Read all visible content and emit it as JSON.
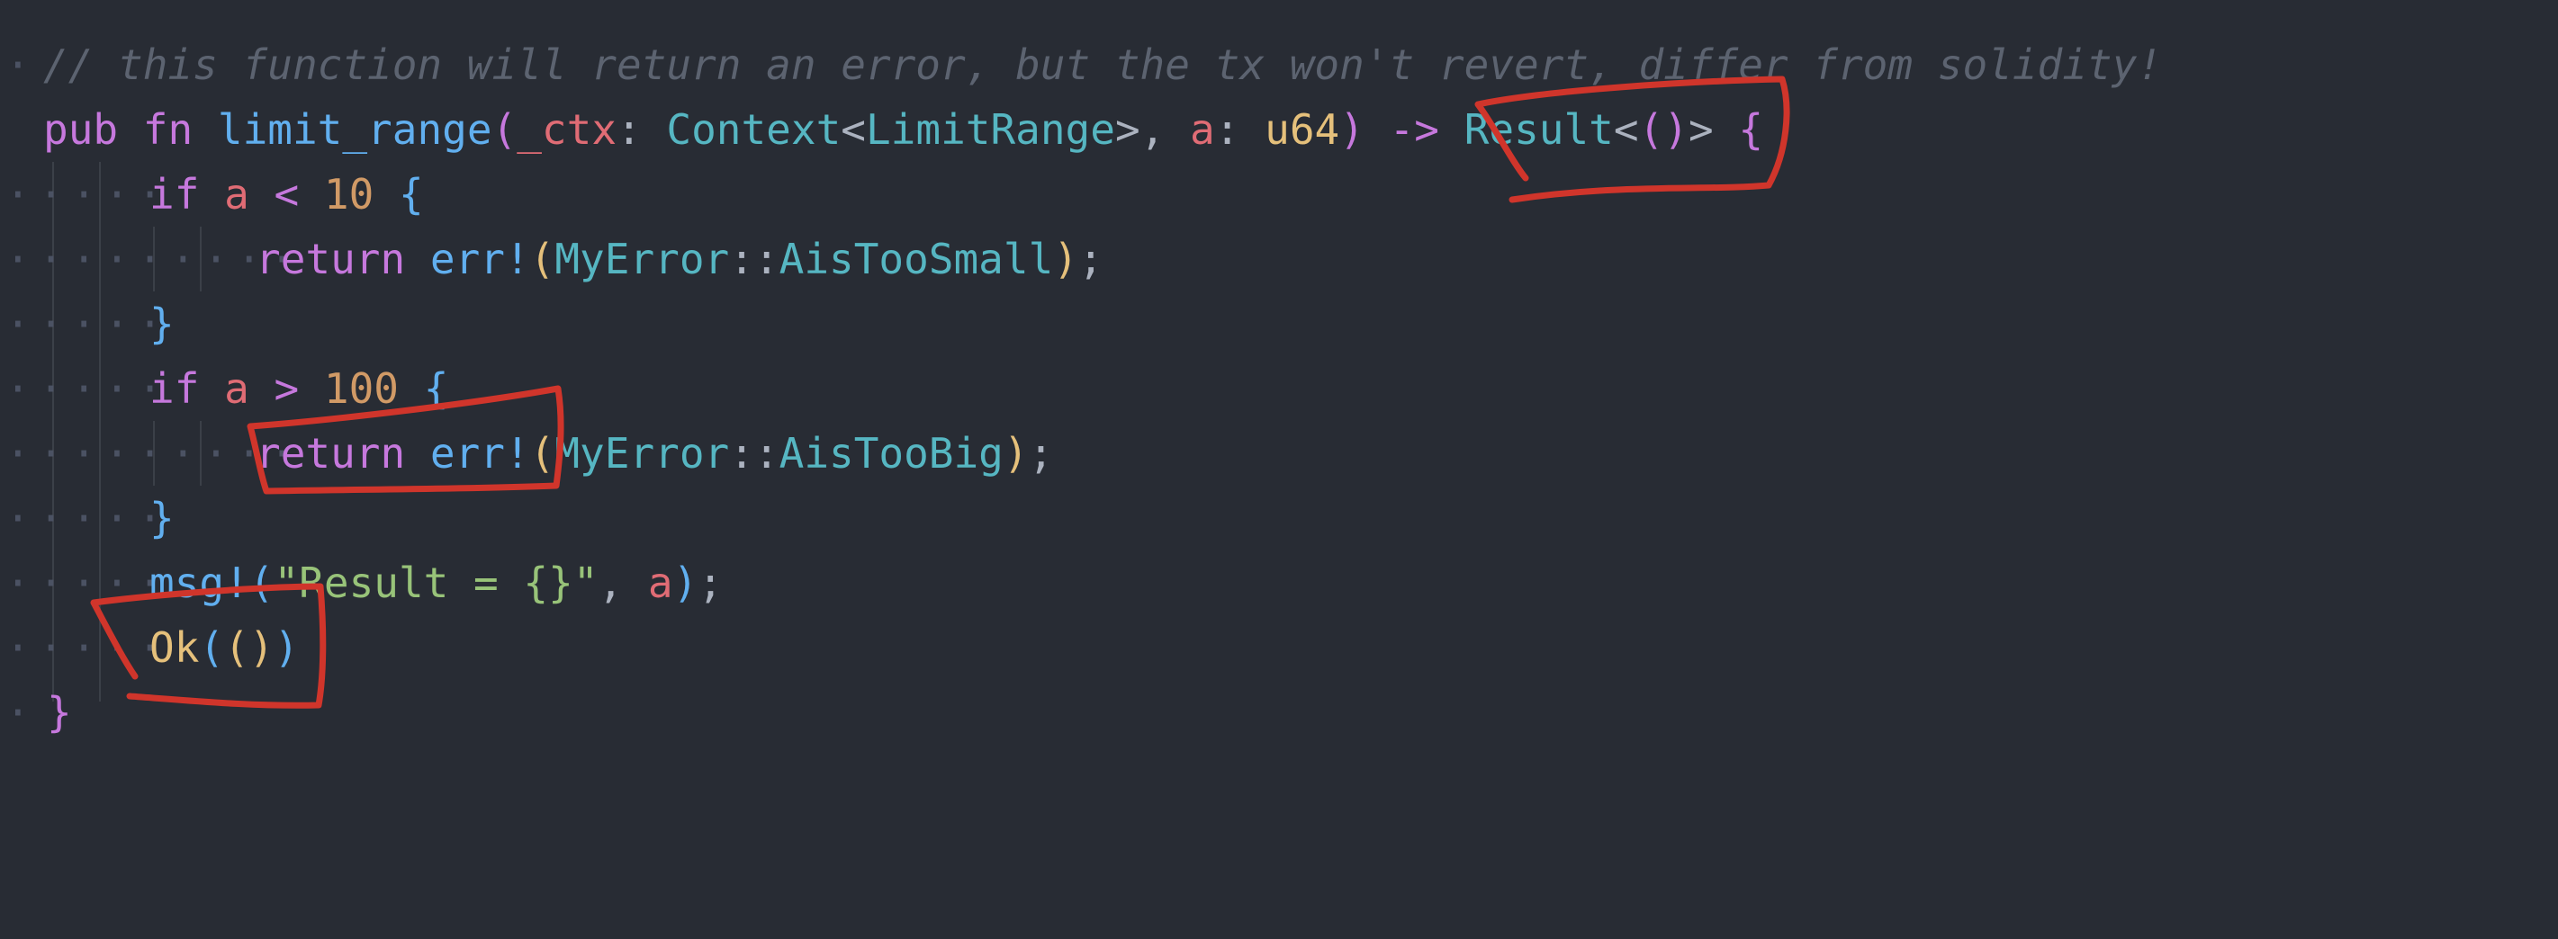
{
  "editor": {
    "theme_colors": {
      "background": "#282c34",
      "comment": "#5c6370",
      "keyword": "#c678dd",
      "function": "#61afef",
      "param": "#e06c75",
      "type": "#56b6c2",
      "number": "#d19a66",
      "string": "#98c379",
      "annotation": "#d0352b"
    },
    "lines": {
      "l1": {
        "comment": "// this function will return an error, but the tx won't revert, differ from solidity!"
      },
      "l2": {
        "kw_pub": "pub",
        "kw_fn": "fn",
        "fn_name": "limit_range",
        "paren_open": "(",
        "p1": "_ctx",
        "colon1": ": ",
        "t1": "Context",
        "lt": "<",
        "t2": "LimitRange",
        "gt_comma": ">, ",
        "p2": "a",
        "colon2": ": ",
        "t3": "u64",
        "paren_close": ")",
        "arrow": " -> ",
        "t4": "Result",
        "lt2": "<",
        "unit": "()",
        "gt2": ">",
        "brace": " {"
      },
      "l3": {
        "kw_if": "if",
        "var": "a",
        "op": "<",
        "num": "10",
        "brace": "{"
      },
      "l4": {
        "kw_return": "return",
        "macro": "err!",
        "po": "(",
        "path_a": "MyError",
        "sep": "::",
        "path_b": "AisTooSmall",
        "pc": ")",
        "semi": ";"
      },
      "l5": {
        "brace": "}"
      },
      "l6": {
        "kw_if": "if",
        "var": "a",
        "op": ">",
        "num": "100",
        "brace": "{"
      },
      "l7": {
        "kw_return": "return",
        "macro": "err!",
        "po": "(",
        "path_a": "MyError",
        "sep": "::",
        "path_b": "AisTooBig",
        "pc": ")",
        "semi": ";"
      },
      "l8": {
        "brace": "}"
      },
      "l9": {
        "macro": "msg!",
        "po": "(",
        "str": "\"Result = {}\"",
        "comma": ", ",
        "var": "a",
        "pc": ")",
        "semi": ";"
      },
      "l10": {
        "ok": "Ok",
        "po": "(",
        "unit": "()",
        "pc": ")"
      },
      "l11": {
        "brace": "}"
      }
    },
    "dots": {
      "d1": "·",
      "d2": "",
      "d3": "·····",
      "d4": "·········",
      "d5": "·····",
      "d6": "·····",
      "d7": "·········",
      "d8": "·····",
      "d9": "·····",
      "d10": "·····",
      "d11": "·"
    }
  }
}
